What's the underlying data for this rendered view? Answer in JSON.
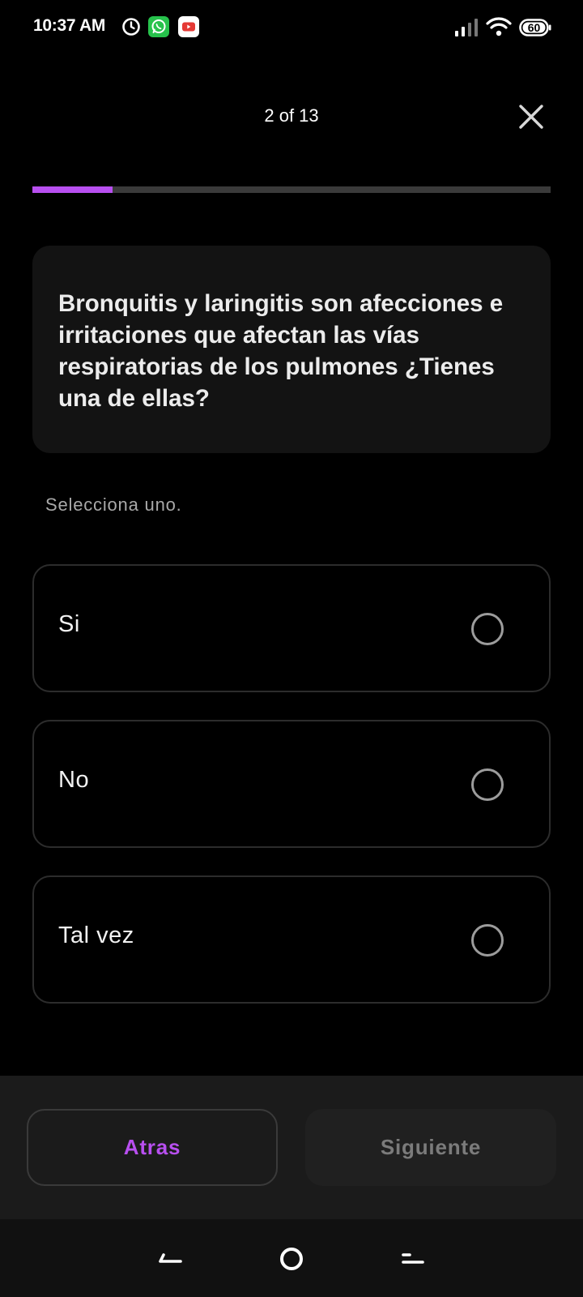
{
  "status_bar": {
    "time": "10:37 AM",
    "battery_level": "60",
    "icons": [
      "clock-icon",
      "whatsapp-icon",
      "youtube-icon",
      "signal-icon",
      "wifi-icon",
      "battery-icon"
    ]
  },
  "header": {
    "progress_label": "2 of 13",
    "progress_fraction": 0.154,
    "close_icon": "close-icon"
  },
  "question": {
    "text": "Bronquitis y laringitis son afecciones e irritaciones que afectan las vías respiratorias de los pulmones ¿Tienes una de ellas?"
  },
  "instruction": "Selecciona uno.",
  "options": [
    {
      "label": "Si",
      "selected": false
    },
    {
      "label": "No",
      "selected": false
    },
    {
      "label": "Tal vez",
      "selected": false
    }
  ],
  "actions": {
    "back_label": "Atras",
    "next_label": "Siguiente"
  },
  "colors": {
    "accent": "#b84ff0",
    "background": "#000000",
    "card": "#131313",
    "disabled_text": "#7b7b7b"
  }
}
